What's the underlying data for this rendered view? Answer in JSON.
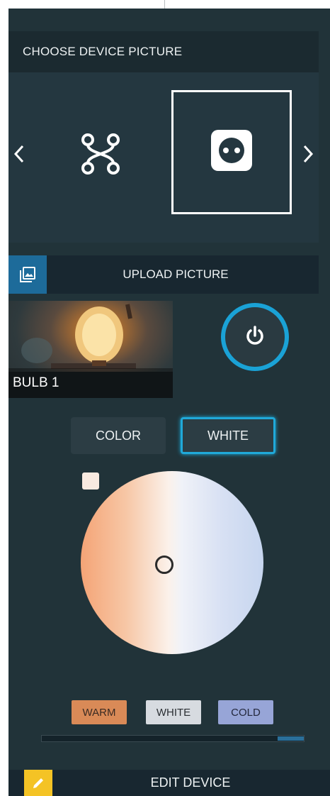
{
  "picture_section": {
    "title": "CHOOSE DEVICE PICTURE",
    "options": [
      {
        "icon": "graph-nodes-icon",
        "selected": false
      },
      {
        "icon": "power-socket-icon",
        "selected": true
      }
    ]
  },
  "upload": {
    "label": "UPLOAD PICTURE",
    "icon": "image-icon"
  },
  "device": {
    "name": "BULB 1",
    "power_icon": "power-icon",
    "power_state": "on"
  },
  "mode_tabs": {
    "color": "COLOR",
    "white": "WHITE",
    "active": "WHITE"
  },
  "white_presets": {
    "warm": "WARM",
    "white": "WHITE",
    "cold": "COLD"
  },
  "brightness": {
    "value": 0.1
  },
  "edit": {
    "label": "EDIT DEVICE",
    "icon": "pencil-icon"
  },
  "colors": {
    "panel_bg": "#213339",
    "accent_blue": "#1aa2d6",
    "edit_yellow": "#f4c325",
    "warm": "#d98a57",
    "cold": "#97a5d7"
  }
}
